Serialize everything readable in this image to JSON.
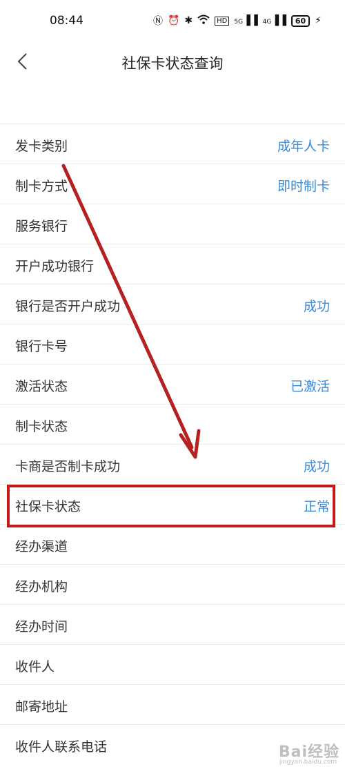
{
  "status_bar": {
    "time": "08:44",
    "signal1": "5G",
    "signal2": "4G",
    "battery": "60"
  },
  "header": {
    "title": "社保卡状态查询"
  },
  "rows": [
    {
      "label": "发卡类别",
      "value": "成年人卡"
    },
    {
      "label": "制卡方式",
      "value": "即时制卡"
    },
    {
      "label": "服务银行",
      "value": ""
    },
    {
      "label": "开户成功银行",
      "value": ""
    },
    {
      "label": "银行是否开户成功",
      "value": "成功"
    },
    {
      "label": "银行卡号",
      "value": ""
    },
    {
      "label": "激活状态",
      "value": "已激活"
    },
    {
      "label": "制卡状态",
      "value": ""
    },
    {
      "label": "卡商是否制卡成功",
      "value": "成功"
    },
    {
      "label": "社保卡状态",
      "value": "正常"
    },
    {
      "label": "经办渠道",
      "value": ""
    },
    {
      "label": "经办机构",
      "value": ""
    },
    {
      "label": "经办时间",
      "value": ""
    },
    {
      "label": "收件人",
      "value": ""
    },
    {
      "label": "邮寄地址",
      "value": ""
    },
    {
      "label": "收件人联系电话",
      "value": ""
    }
  ],
  "watermark": {
    "text": "Bai经验",
    "sub": "jingyan.baidu.com"
  },
  "colors": {
    "value_text": "#3b8ad9",
    "annotation_red": "#c21a1a"
  }
}
